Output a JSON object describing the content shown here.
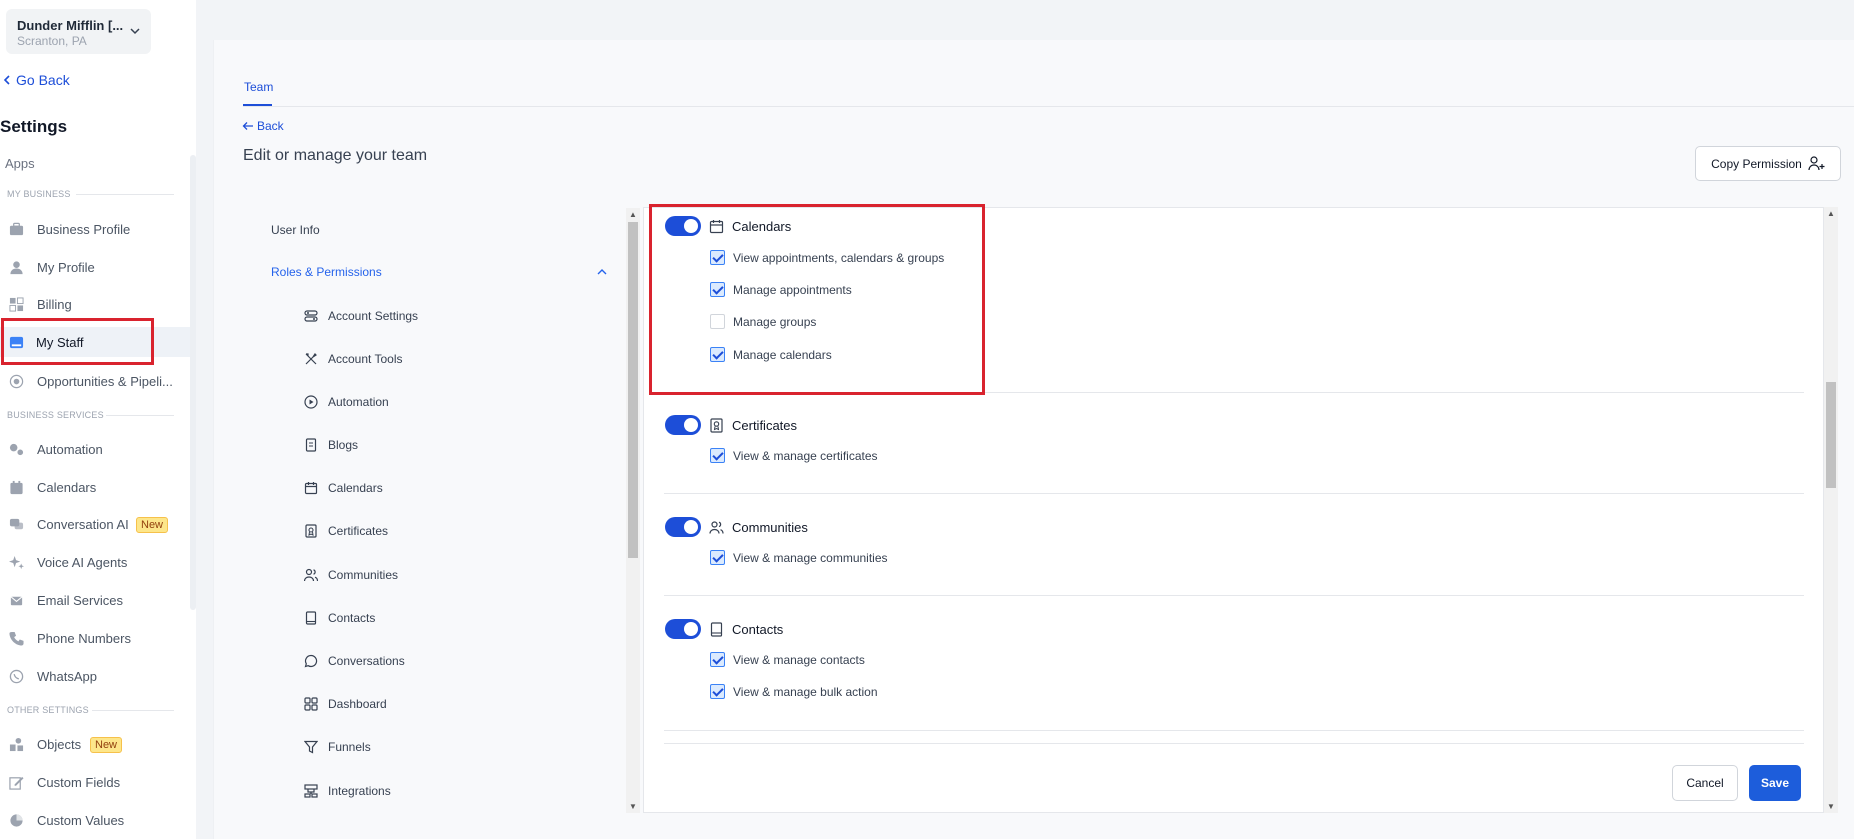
{
  "location": {
    "name": "Dunder Mifflin [...",
    "city": "Scranton, PA"
  },
  "nav": {
    "go_back": "Go Back",
    "settings_title": "Settings",
    "apps": "Apps"
  },
  "sidebar": {
    "sections": [
      "MY BUSINESS",
      "BUSINESS SERVICES",
      "OTHER SETTINGS"
    ],
    "items": [
      {
        "label": "Business Profile",
        "icon": "briefcase-icon"
      },
      {
        "label": "My Profile",
        "icon": "user-icon"
      },
      {
        "label": "Billing",
        "icon": "grid-icon"
      },
      {
        "label": "My Staff",
        "icon": "staff-icon",
        "active": true
      },
      {
        "label": "Opportunities & Pipeli...",
        "icon": "target-icon"
      },
      {
        "label": "Automation",
        "icon": "gears-icon"
      },
      {
        "label": "Calendars",
        "icon": "calendar-icon"
      },
      {
        "label": "Conversation AI",
        "icon": "chat-icon",
        "badge": "New"
      },
      {
        "label": "Voice AI Agents",
        "icon": "sparkle-icon"
      },
      {
        "label": "Email Services",
        "icon": "mail-icon"
      },
      {
        "label": "Phone Numbers",
        "icon": "phone-icon"
      },
      {
        "label": "WhatsApp",
        "icon": "whatsapp-icon"
      },
      {
        "label": "Objects",
        "icon": "objects-icon",
        "badge": "New"
      },
      {
        "label": "Custom Fields",
        "icon": "edit-icon"
      },
      {
        "label": "Custom Values",
        "icon": "pie-icon"
      }
    ]
  },
  "header": {
    "tab": "Team",
    "back": "Back",
    "title": "Edit or manage your team",
    "copy_permission": "Copy Permission"
  },
  "subnav": {
    "user_info": "User Info",
    "roles": "Roles & Permissions",
    "items": [
      "Account Settings",
      "Account Tools",
      "Automation",
      "Blogs",
      "Calendars",
      "Certificates",
      "Communities",
      "Contacts",
      "Conversations",
      "Dashboard",
      "Funnels",
      "Integrations"
    ]
  },
  "permissions": [
    {
      "title": "Calendars",
      "enabled": true,
      "items": [
        {
          "label": "View appointments, calendars & groups",
          "checked": true
        },
        {
          "label": "Manage appointments",
          "checked": true
        },
        {
          "label": "Manage groups",
          "checked": false
        },
        {
          "label": "Manage calendars",
          "checked": true
        }
      ]
    },
    {
      "title": "Certificates",
      "enabled": true,
      "items": [
        {
          "label": "View & manage certificates",
          "checked": true
        }
      ]
    },
    {
      "title": "Communities",
      "enabled": true,
      "items": [
        {
          "label": "View & manage communities",
          "checked": true
        }
      ]
    },
    {
      "title": "Contacts",
      "enabled": true,
      "items": [
        {
          "label": "View & manage contacts",
          "checked": true
        },
        {
          "label": "View & manage bulk action",
          "checked": true
        }
      ]
    }
  ],
  "actions": {
    "cancel": "Cancel",
    "save": "Save"
  },
  "colors": {
    "accent": "#1d4ed8",
    "highlight": "#d9232e",
    "badge": "#fde68a"
  }
}
